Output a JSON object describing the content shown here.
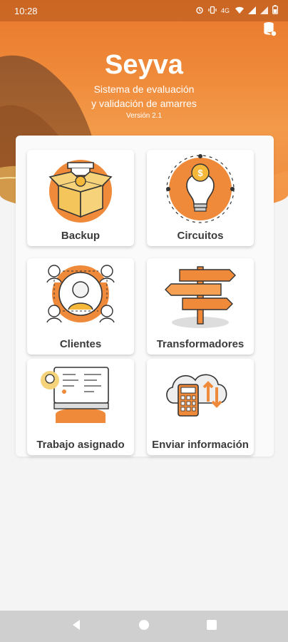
{
  "status_bar": {
    "time": "10:28",
    "icons": [
      "alarm-icon",
      "vibrate-icon",
      "network-icon",
      "wifi-icon",
      "signal-icon",
      "signal-icon",
      "battery-icon"
    ]
  },
  "header": {
    "title": "Seyva",
    "subtitle_line1": "Sistema de evaluación",
    "subtitle_line2": "y validación de amarres",
    "version": "Versión 2.1",
    "action_icon": "database-icon"
  },
  "menu": [
    {
      "id": "backup",
      "label": "Backup",
      "icon": "open-box-icon"
    },
    {
      "id": "circuitos",
      "label": "Circuitos",
      "icon": "lightbulb-coin-icon"
    },
    {
      "id": "clientes",
      "label": "Clientes",
      "icon": "customer-network-icon"
    },
    {
      "id": "transformadores",
      "label": "Transformadores",
      "icon": "signpost-icon"
    },
    {
      "id": "trabajo",
      "label": "Trabajo asignado",
      "icon": "assigned-work-icon"
    },
    {
      "id": "enviar",
      "label": "Enviar información",
      "icon": "cloud-upload-icon"
    }
  ],
  "colors": {
    "accent": "#ef8a3a",
    "accent_dark": "#e46f1f",
    "card_bg": "#ffffff",
    "label_text": "#3b3b3b",
    "navbar": "#cfcfcf"
  },
  "navigation": [
    "back-icon",
    "home-icon",
    "recents-icon"
  ]
}
